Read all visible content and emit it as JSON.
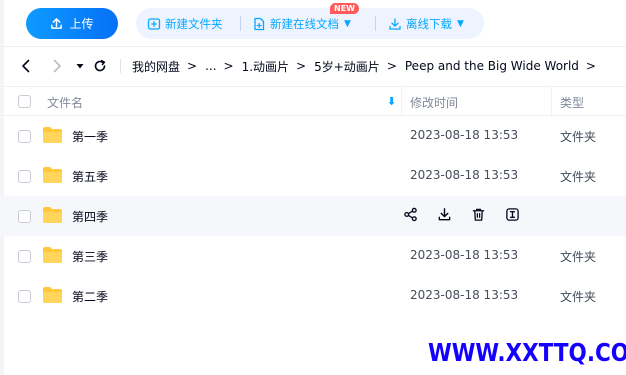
{
  "toolbar": {
    "upload_label": "上传",
    "new_folder_label": "新建文件夹",
    "new_online_doc_label": "新建在线文档",
    "new_badge": "NEW",
    "offline_download_label": "离线下载"
  },
  "nav": {
    "breadcrumbs": [
      "我的网盘",
      "...",
      "1.动画片",
      "5岁+动画片",
      "Peep and the Big Wide World"
    ]
  },
  "table": {
    "columns": {
      "name": "文件名",
      "modified": "修改时间",
      "type": "类型"
    },
    "rows": [
      {
        "name": "第一季",
        "modified": "2023-08-18 13:53",
        "type": "文件夹"
      },
      {
        "name": "第五季",
        "modified": "2023-08-18 13:53",
        "type": "文件夹"
      },
      {
        "name": "第四季",
        "modified": "",
        "type": ""
      },
      {
        "name": "第三季",
        "modified": "2023-08-18 13:53",
        "type": "文件夹"
      },
      {
        "name": "第二季",
        "modified": "2023-08-18 13:53",
        "type": "文件夹"
      }
    ],
    "hover_actions": [
      "share-icon",
      "download-icon",
      "delete-icon",
      "more-icon"
    ]
  },
  "watermark": {
    "text": "WWW.XXTTQ.COM"
  },
  "colors": {
    "accent": "#06a7ff",
    "upload_button": "#0670f7",
    "badge": "#ff5b5b",
    "watermark": "#1400ff",
    "folder": "#ffc83d"
  }
}
